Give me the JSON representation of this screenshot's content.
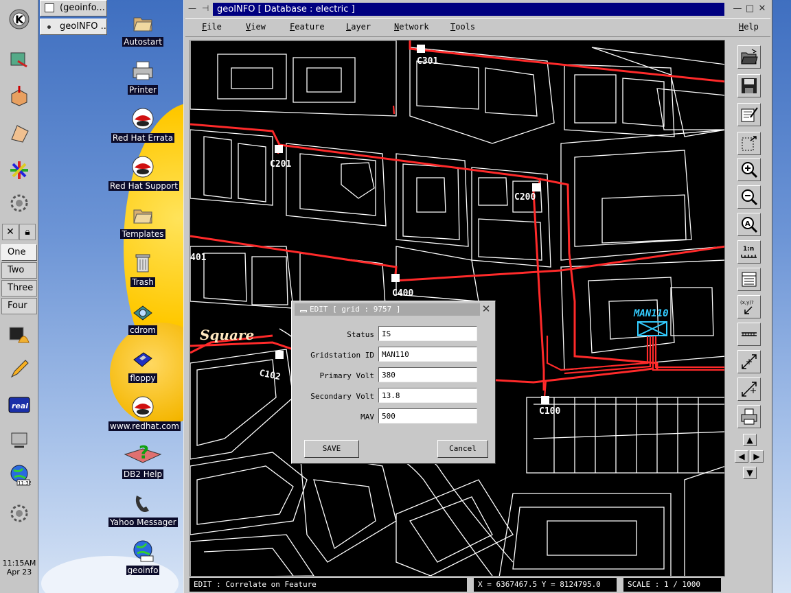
{
  "desktop": {
    "icons": [
      {
        "label": "Autostart",
        "icon": "folder-icon"
      },
      {
        "label": "Printer",
        "icon": "printer-icon"
      },
      {
        "label": "Red Hat Errata",
        "icon": "redhat-icon"
      },
      {
        "label": "Red Hat Support",
        "icon": "redhat-icon"
      },
      {
        "label": "Templates",
        "icon": "folder-icon"
      },
      {
        "label": "Trash",
        "icon": "trash-icon"
      },
      {
        "label": "cdrom",
        "icon": "cdrom-icon"
      },
      {
        "label": "floppy",
        "icon": "floppy-icon"
      },
      {
        "label": "www.redhat.com",
        "icon": "redhat-icon"
      },
      {
        "label": "DB2 Help",
        "icon": "help-book-icon"
      },
      {
        "label": "Yahoo Messager",
        "icon": "phone-icon"
      },
      {
        "label": "geoinfo",
        "icon": "globe-icon"
      }
    ]
  },
  "taskbar": {
    "items": [
      {
        "label": "(geoinfo..."
      },
      {
        "label": "geoINFO ..."
      }
    ]
  },
  "panel": {
    "pager": [
      "One",
      "Two",
      "Three",
      "Four"
    ],
    "clock_time": "11:15AM",
    "clock_date": "Apr 23",
    "globe_time": "11:38"
  },
  "window": {
    "title": "geoINFO  [ Database : electric ]",
    "menu": [
      "File",
      "View",
      "Feature",
      "Layer",
      "Network",
      "Tools",
      "Help"
    ]
  },
  "map": {
    "labels": [
      "C301",
      "C201",
      "C200",
      "401",
      "C400",
      "Square",
      "C102",
      "C100",
      "MAN110"
    ]
  },
  "dialog": {
    "title": "EDIT  [ grid : 9757 ]",
    "fields": [
      {
        "label": "Status",
        "value": "IS"
      },
      {
        "label": "Gridstation ID",
        "value": "MAN110"
      },
      {
        "label": "Primary Volt",
        "value": "380"
      },
      {
        "label": "Secondary Volt",
        "value": "13.8"
      },
      {
        "label": "MAV",
        "value": "500"
      }
    ],
    "save_label": "SAVE",
    "cancel_label": "Cancel"
  },
  "status": {
    "mode": "EDIT : Correlate on Feature",
    "coords": "X = 6367467.5    Y = 8124795.0",
    "scale": "SCALE :  1 / 1000"
  },
  "toolbar": {
    "zoom_ratio_label": "1:n",
    "xy_label": "(x,y)?"
  },
  "colors": {
    "map_background": "#000000",
    "network_line": "#ff2a2a",
    "gridstation": "#33ccff",
    "title_bar": "#000080"
  }
}
